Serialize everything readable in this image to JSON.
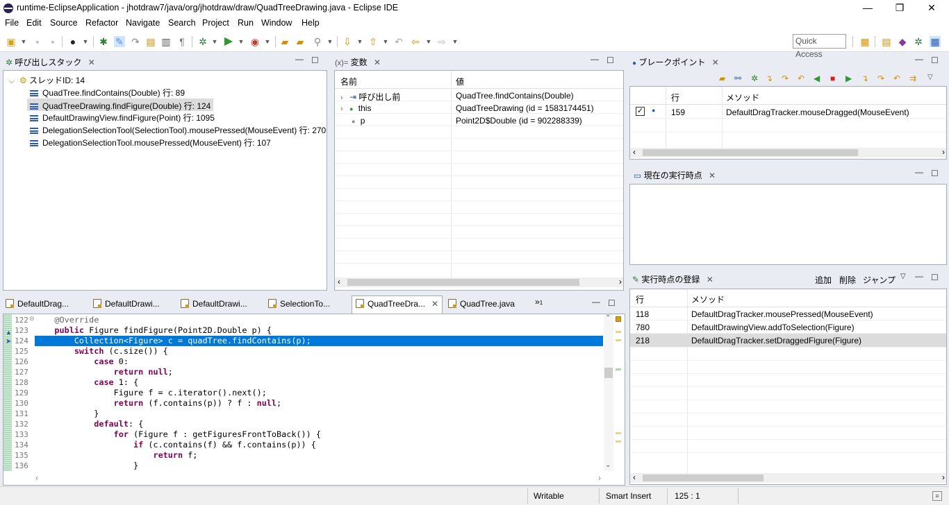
{
  "window": {
    "title": "runtime-EclipseApplication - jhotdraw7/java/org/jhotdraw/draw/QuadTreeDrawing.java - Eclipse IDE",
    "minimize": "—",
    "restore": "❐",
    "close": "✕"
  },
  "menu": [
    "File",
    "Edit",
    "Source",
    "Refactor",
    "Navigate",
    "Search",
    "Project",
    "Run",
    "Window",
    "Help"
  ],
  "toolbar": {
    "quick_access": "Quick Access"
  },
  "callstack": {
    "title": "呼び出しスタック",
    "thread": "スレッドID: 14",
    "frames": [
      "QuadTree.findContains(Double) 行: 89",
      "QuadTreeDrawing.findFigure(Double) 行: 124",
      "DefaultDrawingView.findFigure(Point) 行: 1095",
      "DelegationSelectionTool(SelectionTool).mousePressed(MouseEvent) 行: 270",
      "DelegationSelectionTool.mousePressed(MouseEvent) 行: 107"
    ],
    "selected_index": 1
  },
  "variables": {
    "title": "変数",
    "title_prefix": "(x)=",
    "col_name": "名前",
    "col_value": "値",
    "rows": [
      {
        "name": "呼び出し前",
        "value": "QuadTree.findContains(Double)"
      },
      {
        "name": "this",
        "value": "QuadTreeDrawing (id = 1583174451)"
      },
      {
        "name": "p",
        "value": "Point2D$Double (id = 902288339)"
      }
    ]
  },
  "breakpoints": {
    "title": "ブレークポイント",
    "col_line": "行",
    "col_method": "メソッド",
    "rows": [
      {
        "line": "159",
        "method": "DefaultDragTracker.mouseDragged(MouseEvent)",
        "checked": true
      }
    ]
  },
  "current_point": {
    "title": "現在の実行時点"
  },
  "registration": {
    "title": "実行時点の登録",
    "add": "追加",
    "delete": "削除",
    "jump": "ジャンプ",
    "col_line": "行",
    "col_method": "メソッド",
    "rows": [
      {
        "line": "118",
        "method": "DefaultDragTracker.mousePressed(MouseEvent)"
      },
      {
        "line": "780",
        "method": "DefaultDrawingView.addToSelection(Figure)"
      },
      {
        "line": "218",
        "method": "DefaultDragTracker.setDraggedFigure(Figure)"
      }
    ],
    "selected_index": 2
  },
  "editor": {
    "tabs": [
      "DefaultDrag...",
      "DefaultDrawi...",
      "DefaultDrawi...",
      "SelectionTo...",
      "QuadTreeDra...",
      "QuadTree.java"
    ],
    "active_tab": 4,
    "overflow": "»",
    "overflow_count": "1",
    "lines": [
      {
        "n": "122",
        "code": "    @Override"
      },
      {
        "n": "123",
        "code": "    public Figure findFigure(Point2D.Double p) {"
      },
      {
        "n": "124",
        "code": "        Collection<Figure> c = quadTree.findContains(p);"
      },
      {
        "n": "125",
        "code": "        switch (c.size()) {"
      },
      {
        "n": "126",
        "code": "            case 0:"
      },
      {
        "n": "127",
        "code": "                return null;"
      },
      {
        "n": "128",
        "code": "            case 1: {"
      },
      {
        "n": "129",
        "code": "                Figure f = c.iterator().next();"
      },
      {
        "n": "130",
        "code": "                return (f.contains(p)) ? f : null;"
      },
      {
        "n": "131",
        "code": "            }"
      },
      {
        "n": "132",
        "code": "            default: {"
      },
      {
        "n": "133",
        "code": "                for (Figure f : getFiguresFrontToBack()) {"
      },
      {
        "n": "134",
        "code": "                    if (c.contains(f) && f.contains(p)) {"
      },
      {
        "n": "135",
        "code": "                        return f;"
      },
      {
        "n": "136",
        "code": "                    }"
      }
    ],
    "highlight_line": "124"
  },
  "status": {
    "writable": "Writable",
    "insert": "Smart Insert",
    "position": "125 : 1"
  },
  "colors": {
    "selection": "#0078d7",
    "keyword": "#7f0055",
    "frame_icon": "#2a5aa8"
  }
}
